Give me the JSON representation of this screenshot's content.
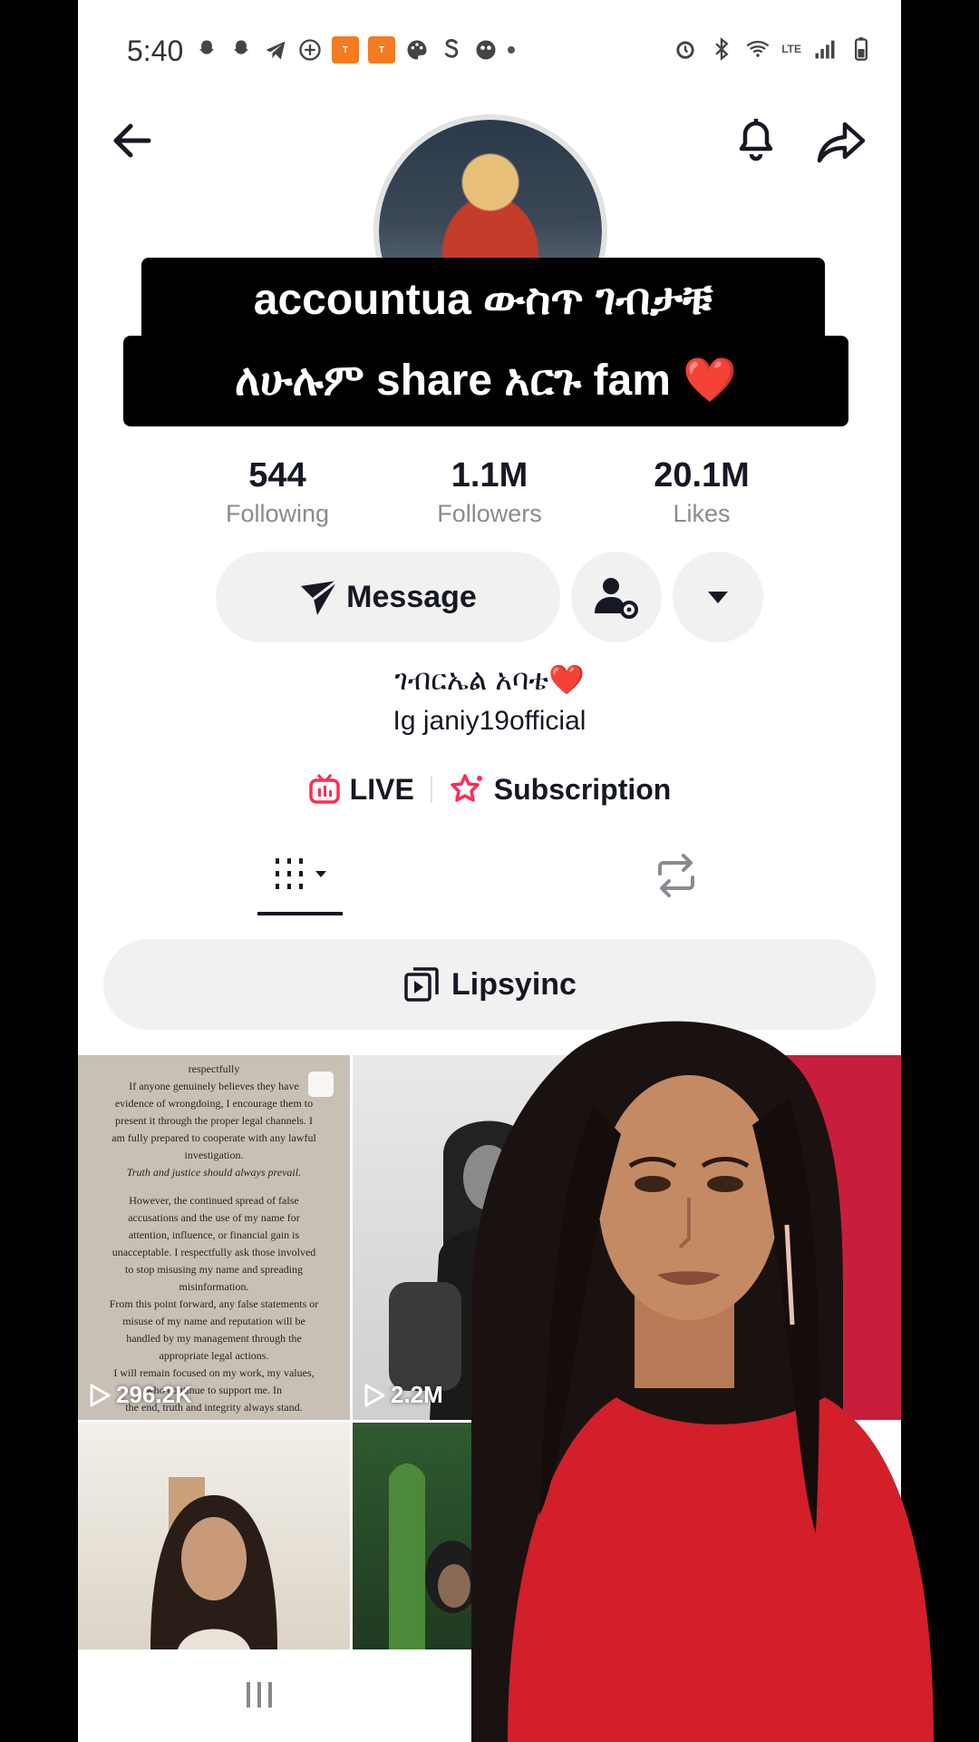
{
  "status_bar": {
    "time": "5:40",
    "network": "LTE"
  },
  "caption": {
    "line1": "accountua ውስጥ ገብታቹ",
    "line2_text": "ለሁሉም share አርጉ fam",
    "line2_emoji": "❤️"
  },
  "stats": [
    {
      "value": "544",
      "label": "Following"
    },
    {
      "value": "1.1M",
      "label": "Followers"
    },
    {
      "value": "20.1M",
      "label": "Likes"
    }
  ],
  "actions": {
    "message_label": "Message"
  },
  "bio": {
    "name_line": "ገብርኤል አባቴ",
    "name_emoji": "❤️",
    "line2": "Ig janiy19official"
  },
  "links": {
    "live_label": "LIVE",
    "subscription_label": "Subscription"
  },
  "playlist": {
    "label": "Lipsyinc"
  },
  "videos": [
    {
      "views": "296.2K"
    },
    {
      "views": "2.2M"
    }
  ],
  "statement": {
    "lines": [
      "respectfully",
      "If anyone genuinely believes they have",
      "evidence of wrongdoing, I encourage them to",
      "present it through the proper legal channels. I",
      "am fully prepared to cooperate with any lawful",
      "investigation.",
      "Truth and justice should always prevail.",
      "",
      "However, the continued spread of false",
      "accusations and the use of my name for",
      "attention, influence, or financial gain is",
      "unacceptable. I respectfully ask those involved",
      "to stop misusing my name and spreading",
      "misinformation.",
      "From this point forward, any false statements or",
      "misuse of my name and reputation will be",
      "handled by my management through the",
      "appropriate legal actions.",
      "I will remain focused on my work, my values,",
      "who continue to support me. In",
      "the end, truth and integrity always stand."
    ]
  },
  "colors": {
    "accent_pink": "#fe2c55",
    "live_pink": "#fe2c55",
    "heart_red": "#e3131b"
  }
}
